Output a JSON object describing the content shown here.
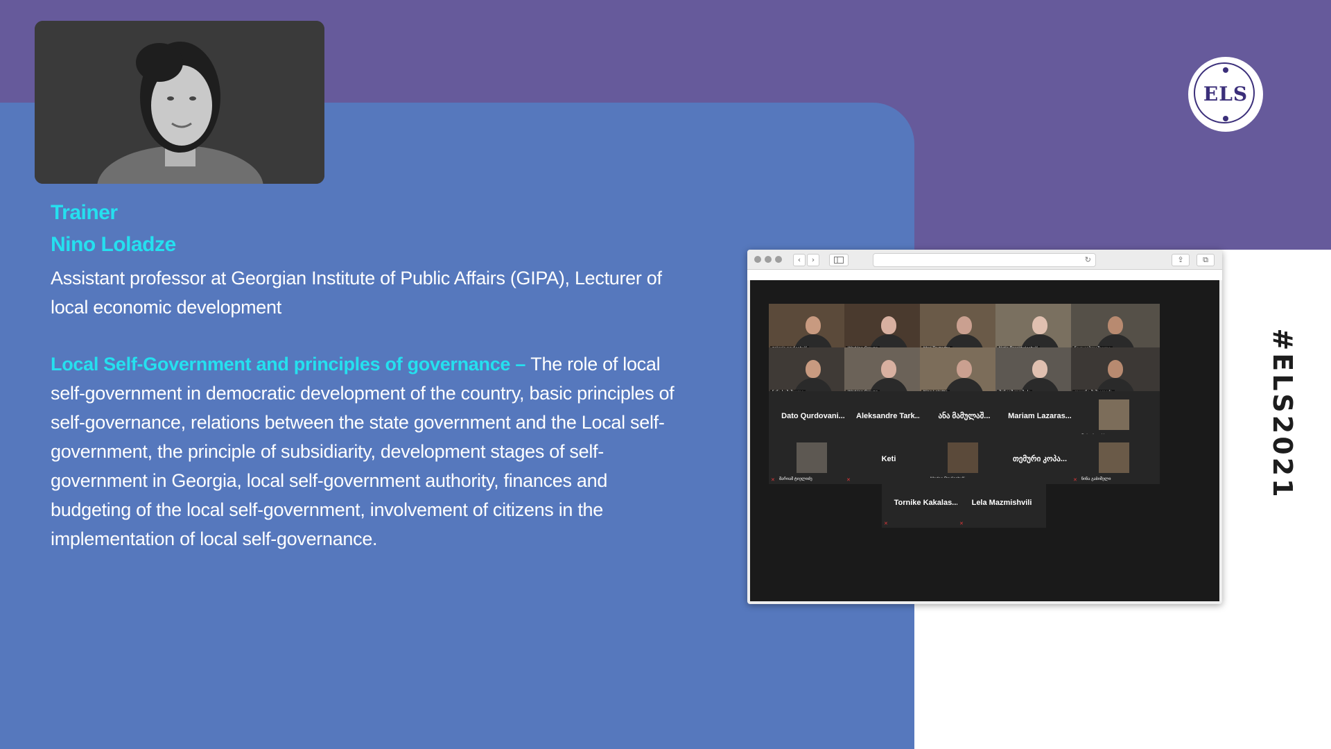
{
  "slide": {
    "role_label": "Trainer",
    "trainer_name": "Nino Loladze",
    "bio": "Assistant professor at Georgian Institute of Public Affairs (GIPA), Lecturer of local economic development",
    "course_title": "Local Self-Government and principles of governance",
    "course_separator": " – ",
    "course_description": "The role of local self-government in democratic development of the country, basic principles of self-governance, relations between the state government and the Local self-government, the principle of subsidiarity, development stages of self-government in Georgia, local self-government authority, finances and budgeting of the local self-government, involvement of citizens in the implementation of local self-governance.",
    "hashtag": "#ELS2021"
  },
  "logo": {
    "text": "ELS",
    "color": "#3b2f7a"
  },
  "colors": {
    "purple": "#665a9b",
    "blue": "#5678bd",
    "accent": "#25e0ef",
    "white": "#ffffff"
  },
  "browser": {
    "icons": [
      "back-icon",
      "forward-icon",
      "sidebar-icon",
      "reload-icon",
      "share-icon",
      "tabs-icon"
    ],
    "back_glyph": "‹",
    "forward_glyph": "›",
    "reload_glyph": "↻",
    "share_glyph": "⇪",
    "tabs_glyph": "⧉"
  },
  "meeting": {
    "mic_glyph": "✕",
    "participants": [
      {
        "name": "zakaria pavliashvili",
        "video": true
      },
      {
        "name": "Working Groups",
        "video": true
      },
      {
        "name": "Meri Tevzadze",
        "video": true
      },
      {
        "name": "Natia Parekhelashvili",
        "video": true
      },
      {
        "name": "ნიკა გაბლიშვილი",
        "video": true
      },
      {
        "name": "ნაჩა ხამაშვილი",
        "video": true
      },
      {
        "name": "Working Groups",
        "video": true
      },
      {
        "name": "Nino Loladze",
        "video": true,
        "active": true
      },
      {
        "name": "მარიამ ლომიძე",
        "video": true
      },
      {
        "name": "ლევანი მიშველაძე",
        "video": true
      },
      {
        "name": "Dato Qurdovani...",
        "video": false
      },
      {
        "name": "Aleksandre Tark...",
        "video": false
      },
      {
        "name": "ანა მამულაშ...",
        "video": false
      },
      {
        "name": "Mariam Lazaras...",
        "video": false
      },
      {
        "name": "Beka Azanidze",
        "video": false,
        "avatar": true
      },
      {
        "name": "მარიამ ტიელიძე",
        "video": false,
        "avatar": true
      },
      {
        "name": "Keti",
        "video": false
      },
      {
        "name": "Medea Pavliashvili",
        "video": false,
        "avatar": true
      },
      {
        "name": "თემური კოპა...",
        "video": false
      },
      {
        "name": "ნინა გაბიშელი",
        "video": false,
        "avatar": true
      },
      {
        "name": "Tornike Kakalas...",
        "video": false
      },
      {
        "name": "Lela Mazmishvili",
        "video": false
      }
    ]
  }
}
